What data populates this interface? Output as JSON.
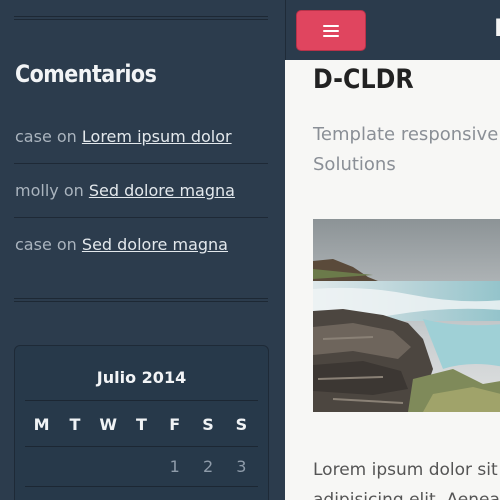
{
  "sidebar": {
    "comments_title": "Comentarios",
    "comments": [
      {
        "author": "case",
        "on": "on",
        "post": "Lorem ipsum dolor"
      },
      {
        "author": "molly",
        "on": "on",
        "post": "Sed dolore magna"
      },
      {
        "author": "case",
        "on": "on",
        "post": "Sed dolore magna"
      }
    ],
    "calendar": {
      "month": "Julio 2014",
      "weekdays": [
        "M",
        "T",
        "W",
        "T",
        "F",
        "S",
        "S"
      ],
      "first_week": [
        "",
        "",
        "",
        "",
        "1",
        "2",
        "3"
      ]
    }
  },
  "header": {
    "menu_icon": "hamburger-icon",
    "brand_partial": "D",
    "accent_color": "#e0455f"
  },
  "post": {
    "title": "D-CLDR",
    "subtitle": "Template responsive Solutions",
    "image": "waterfall-landscape",
    "body_line1": "Lorem ipsum dolor sit",
    "body_line2": "adipisicing elit. Aenea"
  }
}
